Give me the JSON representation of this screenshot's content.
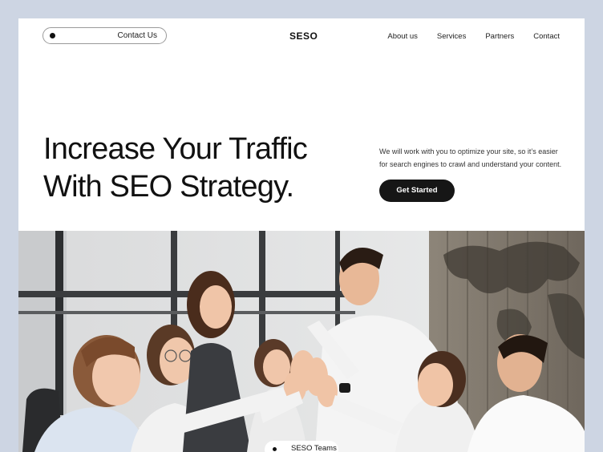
{
  "nav": {
    "contact_pill": "Contact Us",
    "logo": "SESO",
    "links": [
      "About us",
      "Services",
      "Partners",
      "Contact"
    ]
  },
  "hero": {
    "title_lines": [
      "Increase Your Traffic",
      "With SEO Strategy."
    ],
    "description_lines": [
      "We will work with you to optimize your site, so it’s easier",
      "for search engines to crawl and understand your content."
    ],
    "cta_label": "Get Started"
  },
  "photo": {
    "badge_label": "SESO Teams"
  },
  "colors": {
    "page_background": "#cdd5e3",
    "card": "#ffffff",
    "button": "#161616"
  }
}
